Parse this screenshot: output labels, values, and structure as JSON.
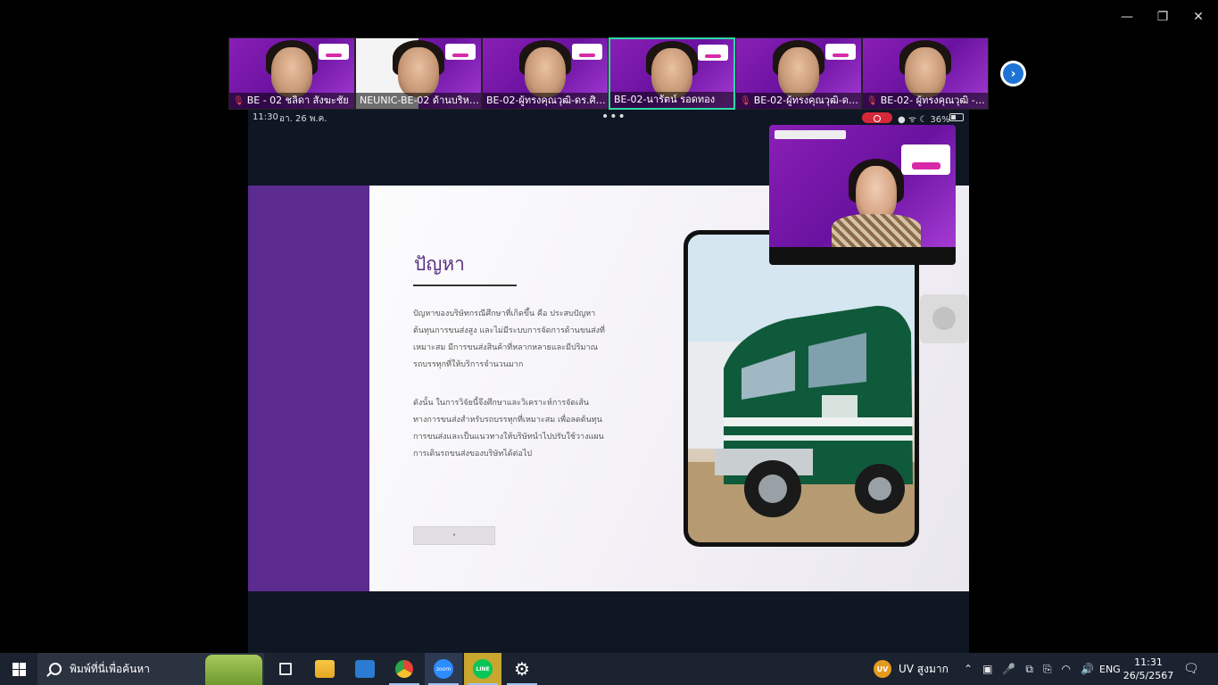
{
  "window": {
    "minimize": "—",
    "restore": "❐",
    "close": "✕"
  },
  "gallery": {
    "participants": [
      {
        "name": "BE - 02 ชลิดา สังฆะชัย",
        "muted": true
      },
      {
        "name": "NEUNIC-BE-02 ด้านบริหารธุ...",
        "muted": false
      },
      {
        "name": "BE-02-ผู้ทรงคุณวุฒิ-ดร.ศิริพ...",
        "muted": false
      },
      {
        "name": "BE-02-นารัตน์ รอดทอง",
        "muted": false,
        "active": true
      },
      {
        "name": "BE-02-ผู้ทรงคุณวุฒิ-ดร...",
        "muted": true
      },
      {
        "name": "BE-02- ผู้ทรงคุณวุฒิ - ดร...",
        "muted": true
      }
    ],
    "next_icon": "›"
  },
  "share": {
    "status_time": "11:30",
    "status_date": "อา. 26 พ.ค.",
    "status_dots": "•••",
    "status_right": "● ᯤ ☾ 36%",
    "slide": {
      "title": "ปัญหา",
      "paragraph1": "ปัญหาของบริษัทกรณีศึกษาที่เกิดขึ้น คือ ประสบปัญหาต้นทุนการขนส่งสูง และไม่มีระบบการจัดการด้านขนส่งที่เหมาะสม มีการขนส่งสินค้าที่หลากหลายและมีปริมาณรถบรรทุกที่ให้บริการจำนวนมาก",
      "paragraph2": "ดังนั้น ในการวิจัยนี้จึงศึกษาและวิเคราะห์การจัดเส้นทางการขนส่งสำหรับรถบรรทุกที่เหมาะสม เพื่อลดต้นทุนการขนส่งและเป็นแนวทางให้บริษัทนำไปปรับใช้วางแผนการเดินรถขนส่งของบริษัทได้ต่อไป",
      "button_label": "•"
    }
  },
  "taskbar": {
    "search_placeholder": "พิมพ์ที่นี่เพื่อค้นหา",
    "zoom_label": "zoom",
    "line_label": "LINE",
    "gear_icon": "⚙",
    "weather_badge": "UV",
    "weather_text": "UV สูงมาก",
    "tray_icons": [
      "⌃",
      "▣",
      "🎤",
      "⧉",
      "⎘",
      "◠",
      "🔊"
    ],
    "language": "ENG",
    "clock_time": "11:31",
    "clock_date": "26/5/2567",
    "notify_icon": "🗨"
  }
}
